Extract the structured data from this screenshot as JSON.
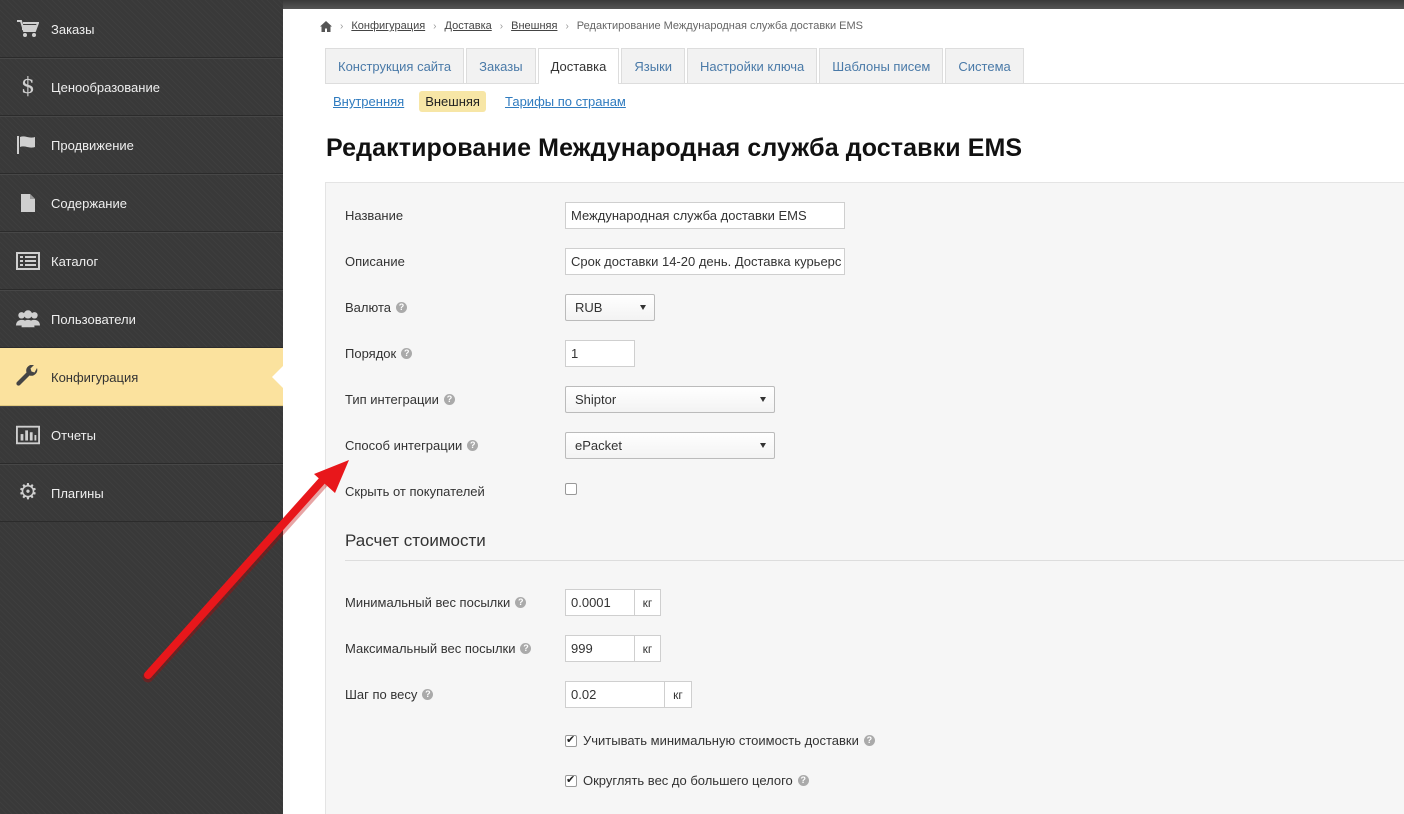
{
  "sidebar": {
    "items": [
      {
        "label": "Заказы",
        "icon": "cart-icon"
      },
      {
        "label": "Ценообразование",
        "icon": "dollar-icon"
      },
      {
        "label": "Продвижение",
        "icon": "flag-icon"
      },
      {
        "label": "Содержание",
        "icon": "document-icon"
      },
      {
        "label": "Каталог",
        "icon": "list-icon"
      },
      {
        "label": "Пользователи",
        "icon": "users-icon"
      },
      {
        "label": "Конфигурация",
        "icon": "wrench-icon",
        "active": true
      },
      {
        "label": "Отчеты",
        "icon": "bar-chart-icon"
      },
      {
        "label": "Плагины",
        "icon": "gear-icon"
      }
    ]
  },
  "breadcrumb": {
    "home_icon": "home-icon",
    "items": [
      "Конфигурация",
      "Доставка",
      "Внешняя"
    ],
    "current": "Редактирование Международная служба доставки EMS"
  },
  "tabs": [
    "Конструкция сайта",
    "Заказы",
    "Доставка",
    "Языки",
    "Настройки ключа",
    "Шаблоны писем",
    "Система"
  ],
  "active_tab": "Доставка",
  "subnav": [
    "Внутренняя",
    "Внешняя",
    "Тарифы по странам"
  ],
  "active_subnav": "Внешняя",
  "page_title": "Редактирование Международная служба доставки EMS",
  "form": {
    "name_label": "Название",
    "name_value": "Международная служба доставки EMS",
    "description_label": "Описание",
    "description_value": "Срок доставки 14-20 день. Доставка курьерс",
    "currency_label": "Валюта",
    "currency_value": "RUB",
    "order_label": "Порядок",
    "order_value": "1",
    "integration_type_label": "Тип интеграции",
    "integration_type_value": "Shiptor",
    "integration_method_label": "Способ интеграции",
    "integration_method_value": "ePacket",
    "hide_label": "Скрыть от покупателей",
    "hide_checked": false
  },
  "cost": {
    "section_title": "Расчет стоимости",
    "min_weight_label": "Минимальный вес посылки",
    "min_weight_value": "0.0001",
    "max_weight_label": "Максимальный вес посылки",
    "max_weight_value": "999",
    "step_label": "Шаг по весу",
    "step_value": "0.02",
    "unit": "кг",
    "min_cost_label": "Учитывать минимальную стоимость доставки",
    "min_cost_checked": true,
    "round_label": "Округлять вес до большего целого",
    "round_checked": true
  },
  "colors": {
    "sidebar_bg": "#393939",
    "sidebar_active": "#fbe29e",
    "link": "#2f7bbf",
    "arrow": "#e8171b"
  }
}
